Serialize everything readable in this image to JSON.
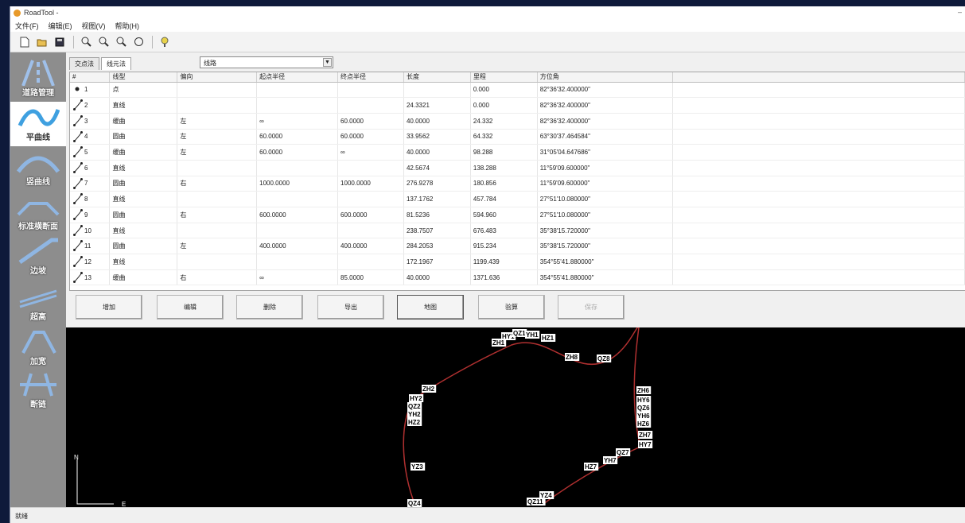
{
  "window": {
    "title": "RoadTool -"
  },
  "menu": [
    "文件(F)",
    "编辑(E)",
    "视图(V)",
    "帮助(H)"
  ],
  "toolbar": [
    "new-icon",
    "open-icon",
    "save-icon",
    "zoom-in-icon",
    "zoom-icon",
    "zoom-out-icon",
    "pan-icon",
    "help-icon"
  ],
  "sidebar": [
    {
      "label": "道路管理",
      "icon": "road-manage-icon"
    },
    {
      "label": "平曲线",
      "icon": "horizontal-curve-icon",
      "active": true
    },
    {
      "label": "竖曲线",
      "icon": "vertical-curve-icon"
    },
    {
      "label": "标准横断面",
      "icon": "cross-section-icon"
    },
    {
      "label": "边坡",
      "icon": "slope-icon"
    },
    {
      "label": "超高",
      "icon": "superelevation-icon"
    },
    {
      "label": "加宽",
      "icon": "widening-icon"
    },
    {
      "label": "断链",
      "icon": "chain-break-icon"
    }
  ],
  "tabs": [
    {
      "label": "交点法"
    },
    {
      "label": "线元法",
      "active": true
    }
  ],
  "combo": {
    "value": "线路"
  },
  "table": {
    "headers": [
      "#",
      "线型",
      "偏向",
      "起点半径",
      "终点半径",
      "长度",
      "里程",
      "方位角"
    ],
    "rows": [
      [
        "1",
        "点",
        "",
        "",
        "",
        "",
        "0.000",
        "82°36'32.400000\""
      ],
      [
        "2",
        "直线",
        "",
        "",
        "",
        "24.3321",
        "0.000",
        "82°36'32.400000\""
      ],
      [
        "3",
        "缓曲",
        "左",
        "∞",
        "60.0000",
        "40.0000",
        "24.332",
        "82°36'32.400000\""
      ],
      [
        "4",
        "圆曲",
        "左",
        "60.0000",
        "60.0000",
        "33.9562",
        "64.332",
        "63°30'37.464584\""
      ],
      [
        "5",
        "缓曲",
        "左",
        "60.0000",
        "∞",
        "40.0000",
        "98.288",
        "31°05'04.647686\""
      ],
      [
        "6",
        "直线",
        "",
        "",
        "",
        "42.5674",
        "138.288",
        "11°59'09.600000\""
      ],
      [
        "7",
        "圆曲",
        "右",
        "1000.0000",
        "1000.0000",
        "276.9278",
        "180.856",
        "11°59'09.600000\""
      ],
      [
        "8",
        "直线",
        "",
        "",
        "",
        "137.1762",
        "457.784",
        "27°51'10.080000\""
      ],
      [
        "9",
        "圆曲",
        "右",
        "600.0000",
        "600.0000",
        "81.5236",
        "594.960",
        "27°51'10.080000\""
      ],
      [
        "10",
        "直线",
        "",
        "",
        "",
        "238.7507",
        "676.483",
        "35°38'15.720000\""
      ],
      [
        "11",
        "圆曲",
        "左",
        "400.0000",
        "400.0000",
        "284.2053",
        "915.234",
        "35°38'15.720000\""
      ],
      [
        "12",
        "直线",
        "",
        "",
        "",
        "172.1967",
        "1199.439",
        "354°55'41.880000\""
      ],
      [
        "13",
        "缓曲",
        "右",
        "∞",
        "85.0000",
        "40.0000",
        "1371.636",
        "354°55'41.880000\""
      ]
    ]
  },
  "buttons": [
    {
      "label": "增加"
    },
    {
      "label": "编辑"
    },
    {
      "label": "删除"
    },
    {
      "label": "导出"
    },
    {
      "label": "地图",
      "focused": true
    },
    {
      "label": "验算"
    },
    {
      "label": "保存",
      "disabled": true
    }
  ],
  "canvas": {
    "compass_n": "N",
    "compass_e": "E",
    "labels": [
      "ZH1",
      "HY1",
      "QZ1",
      "YH1",
      "HZ1",
      "ZH2",
      "HY2",
      "QZ2",
      "YH2",
      "HZ2",
      "YZ3",
      "QZ4",
      "ZH6",
      "HY6",
      "QZ6",
      "YH6",
      "HZ6",
      "ZH7",
      "HY7",
      "QZ7",
      "YH7",
      "HZ7",
      "YZ4",
      "QZ11",
      "ZH8",
      "QZ8"
    ]
  },
  "status": {
    "text": "就绪"
  }
}
